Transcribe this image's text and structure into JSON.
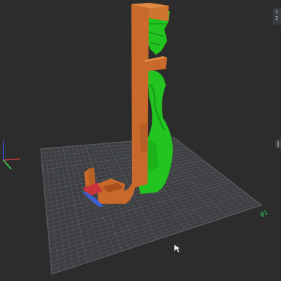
{
  "viewport": {
    "plate_label": "01",
    "corner_label_top": "1",
    "corner_label_bottom": "2"
  },
  "colors": {
    "background": "#2c2c2c",
    "plate": "#3d3f42",
    "grid": "#55585c",
    "model_orange": "#c9692b",
    "support_green": "#22c41f",
    "accent_red": "#c8343a",
    "accent_blue": "#3a5fd0"
  },
  "icons": [
    "mouse-cursor-icon",
    "axis-gizmo-icon"
  ]
}
